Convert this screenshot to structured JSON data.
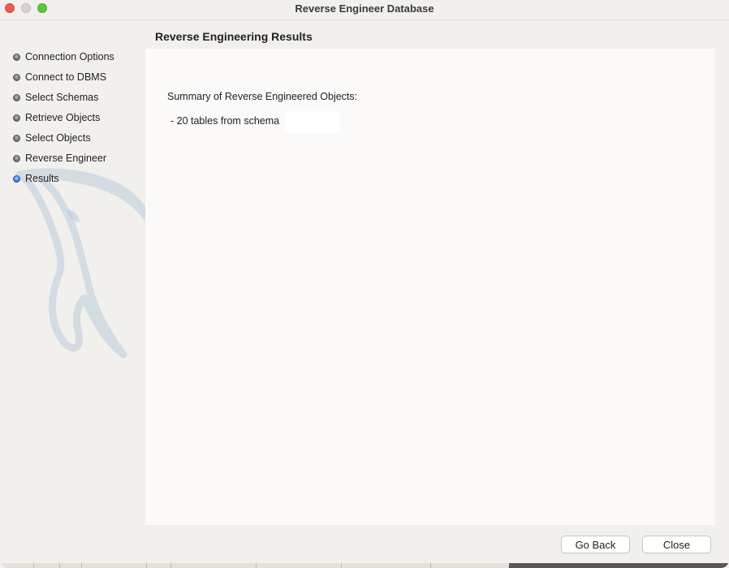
{
  "window": {
    "title": "Reverse Engineer Database"
  },
  "sidebar": {
    "steps": [
      {
        "label": "Connection Options",
        "state": "done"
      },
      {
        "label": "Connect to DBMS",
        "state": "done"
      },
      {
        "label": "Select Schemas",
        "state": "done"
      },
      {
        "label": "Retrieve Objects",
        "state": "done"
      },
      {
        "label": "Select Objects",
        "state": "done"
      },
      {
        "label": "Reverse Engineer",
        "state": "done"
      },
      {
        "label": "Results",
        "state": "active"
      }
    ],
    "watermark_icon": "dolphin-logo-icon"
  },
  "main": {
    "title": "Reverse Engineering Results",
    "summary_label": "Summary of Reverse Engineered Objects:",
    "summary_line": "- 20 tables from schema",
    "schema_name": ""
  },
  "footer": {
    "back_label": "Go Back",
    "close_label": "Close"
  },
  "colors": {
    "active_step": "#2f6ed6",
    "close_light": "#ee5a52",
    "zoom_light": "#5fc43f",
    "minimize_light": "#d7d4d0"
  }
}
